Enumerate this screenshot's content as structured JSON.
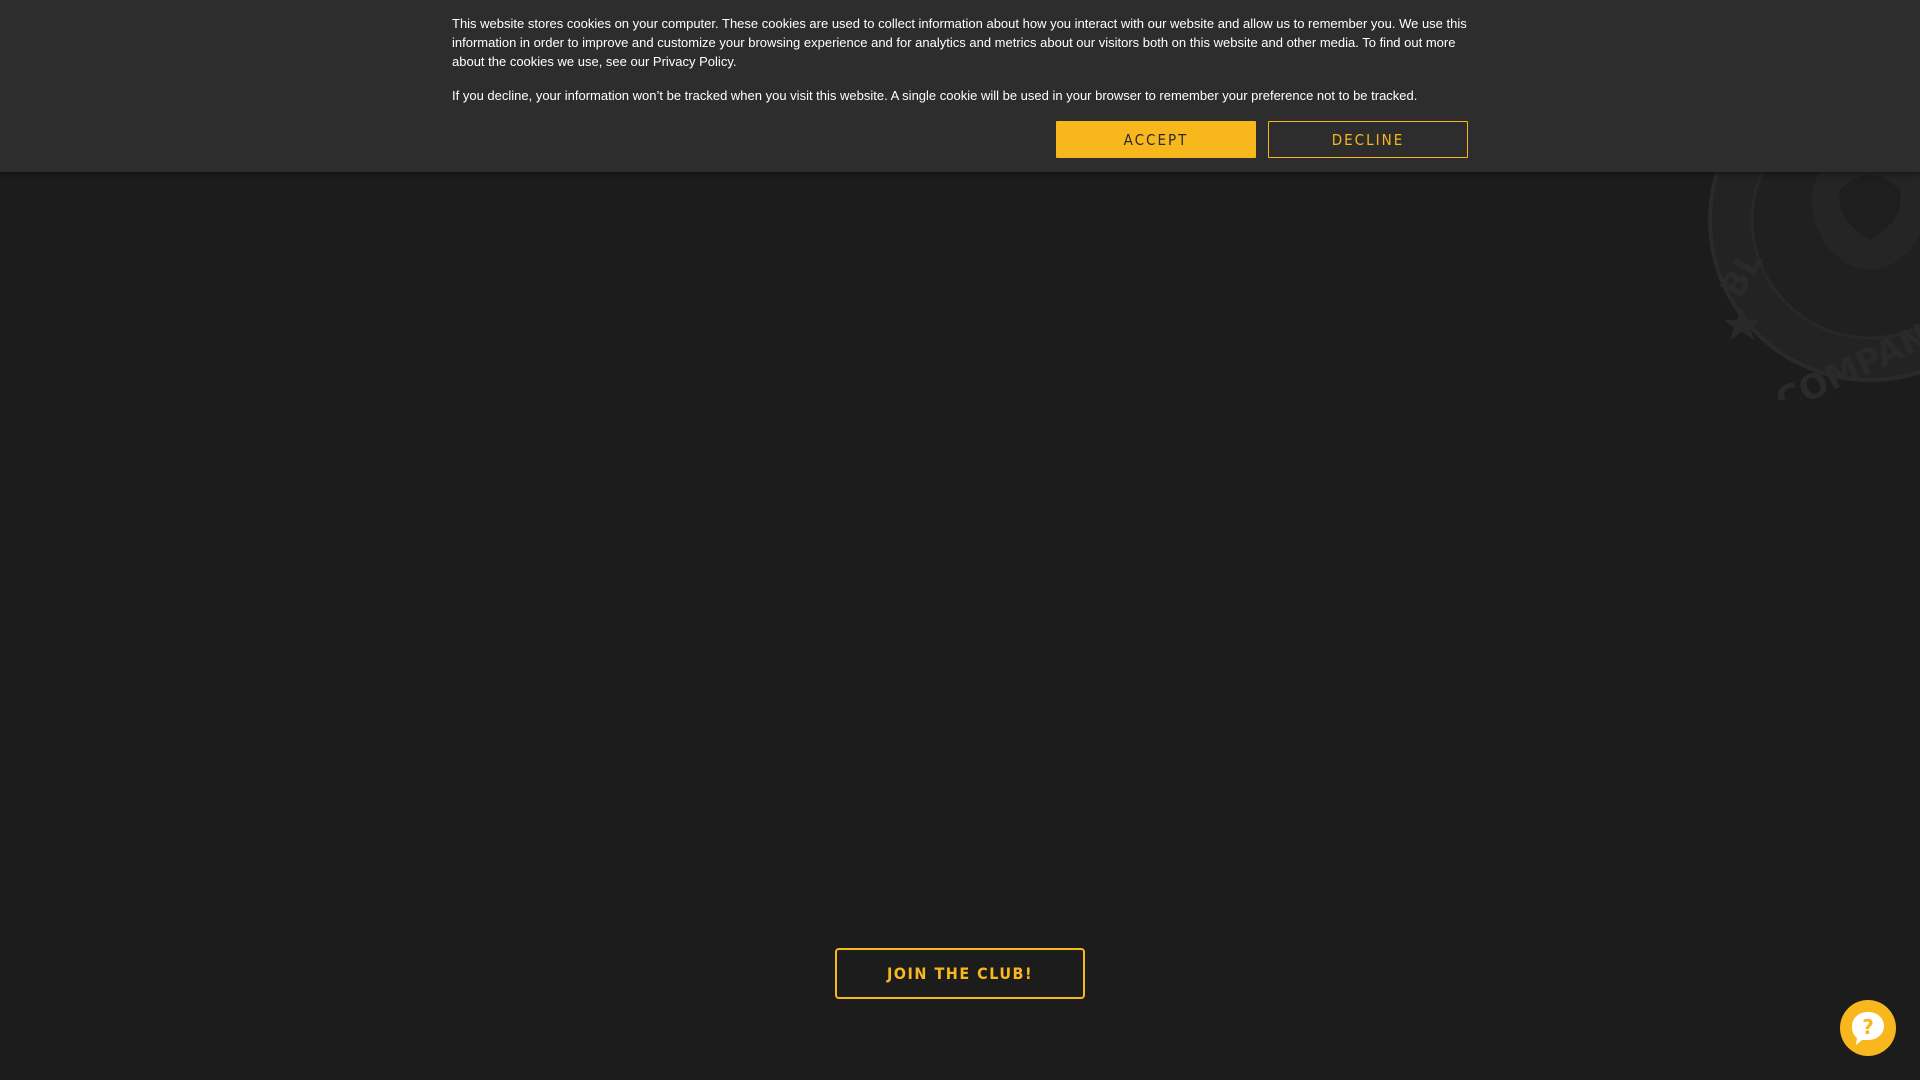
{
  "cookie_banner": {
    "paragraph1_text": "This website stores cookies on your computer. These cookies are used to collect information about how you interact with our website and allow us to remember you. We use this information in order to improve and customize your browsing experience and for analytics and metrics about our visitors both on this website and other media. To find out more about the cookies we use, see our ",
    "privacy_link": "Privacy Policy",
    "paragraph1_end": ".",
    "paragraph2_text": "If you decline, your information won’t be tracked when you visit this website. A single cookie will be used in your browser to remember your preference not to be tracked.",
    "accept_label": "Accept",
    "decline_label": "Decline"
  },
  "main": {
    "join_label": "JOIN THE CLUB!"
  },
  "seal": {
    "text_left": "BL",
    "text_bottom": "COMPANY"
  },
  "help": {
    "icon": "question-chat-icon"
  },
  "colors": {
    "background": "#1c1c1c",
    "banner": "#2d2d2d",
    "accent": "#f8b81d"
  }
}
